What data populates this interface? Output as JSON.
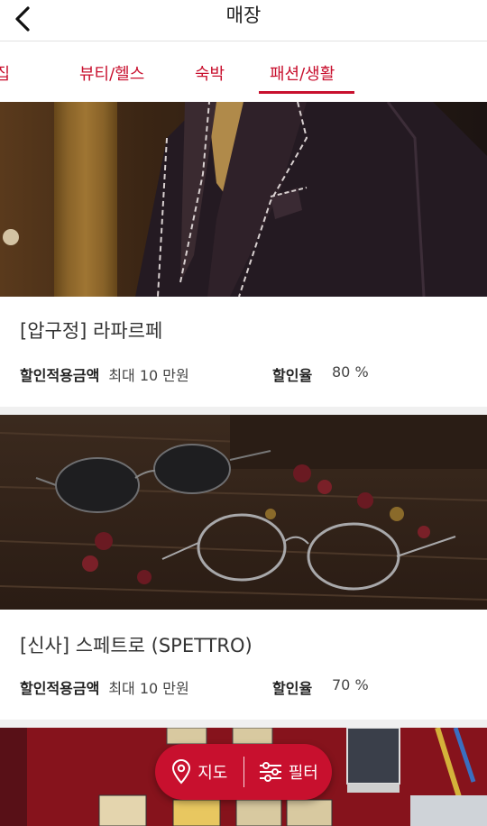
{
  "header": {
    "title": "매장",
    "back_icon": "chevron-left-icon"
  },
  "tabs": [
    {
      "label": "맛집"
    },
    {
      "label": "뷰티/헬스"
    },
    {
      "label": "숙박"
    },
    {
      "label": "패션/생활",
      "active": true
    }
  ],
  "stores": [
    {
      "name": "[압구정] 라파르페",
      "discount_amount_label": "할인적용금액",
      "discount_amount_value": "최대 10 만원",
      "discount_rate_label": "할인율",
      "discount_rate_value": "80 %"
    },
    {
      "name": "[신사] 스페트로 (SPETTRO)",
      "discount_amount_label": "할인적용금액",
      "discount_amount_value": "최대 10 만원",
      "discount_rate_label": "할인율",
      "discount_rate_value": "70 %"
    }
  ],
  "fab": {
    "map_label": "지도",
    "filter_label": "필터",
    "map_icon": "map-pin-icon",
    "filter_icon": "sliders-icon"
  },
  "colors": {
    "accent": "#c8102e"
  }
}
